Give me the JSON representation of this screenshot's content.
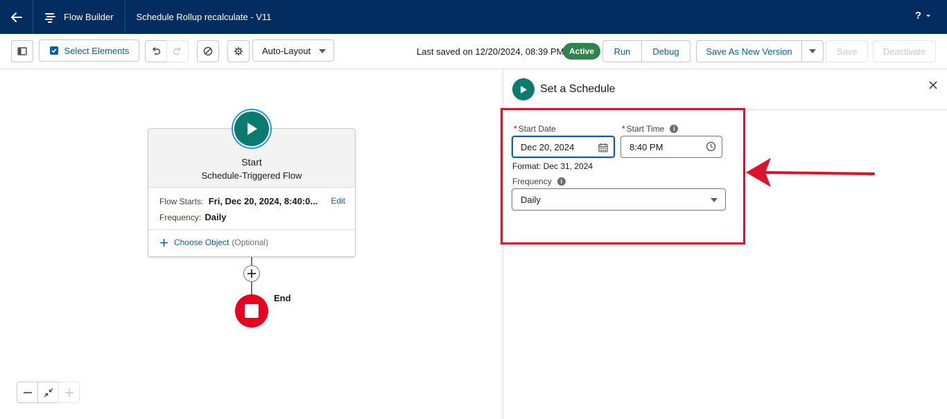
{
  "topbar": {
    "app_label": "Flow Builder",
    "flow_title": "Schedule Rollup recalculate - V11",
    "help_label": "?"
  },
  "toolbar": {
    "select_elements_label": "Select Elements",
    "layout_value": "Auto-Layout",
    "last_saved_text": "Last saved on 12/20/2024, 08:39 PM",
    "status_badge": "Active",
    "run_label": "Run",
    "debug_label": "Debug",
    "save_new_version_label": "Save As New Version",
    "save_label": "Save",
    "deactivate_label": "Deactivate"
  },
  "canvas": {
    "start_title": "Start",
    "start_subtitle": "Schedule-Triggered Flow",
    "flow_starts_label": "Flow Starts:",
    "flow_starts_value": "Fri, Dec 20, 2024, 8:40:0...",
    "edit_label": "Edit",
    "frequency_label": "Frequency:",
    "frequency_value": "Daily",
    "choose_object_label": "Choose Object",
    "choose_object_optional": "(Optional)",
    "end_label": "End"
  },
  "panel": {
    "title": "Set a Schedule",
    "start_date_label": "Start Date",
    "start_date_value": "Dec 20, 2024",
    "start_time_label": "Start Time",
    "start_time_value": "8:40 PM",
    "format_hint": "Format: Dec 31, 2024",
    "frequency_label": "Frequency",
    "frequency_value": "Daily",
    "required_mark": "*",
    "info_mark": "i"
  },
  "colors": {
    "topbar_bg": "#032d60",
    "brand_blue": "#0b5cab",
    "start_teal": "#0c7b6f",
    "end_red": "#ea001e",
    "active_green": "#2e844a",
    "annotation_red": "#e0112b"
  },
  "icons": [
    "back-arrow-icon",
    "flow-builder-icon",
    "help-icon",
    "chevron-down-icon",
    "toggle-panel-icon",
    "checkbox-icon",
    "undo-icon",
    "redo-icon",
    "ban-icon",
    "gear-icon",
    "play-icon",
    "plus-icon",
    "stop-icon",
    "minus-icon",
    "shrink-icon",
    "calendar-icon",
    "clock-icon",
    "info-icon",
    "close-icon",
    "annotation-arrow"
  ]
}
